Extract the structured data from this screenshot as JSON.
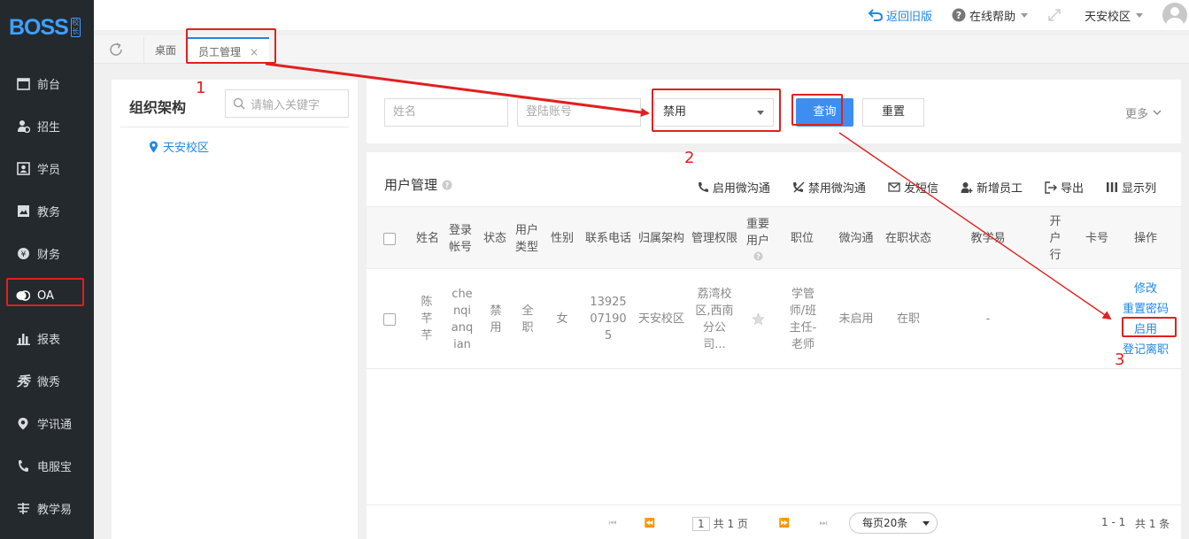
{
  "logo": {
    "text": "BOSS",
    "sub": "校长"
  },
  "sidebar": {
    "items": [
      {
        "label": "前台",
        "icon": "calendar-icon"
      },
      {
        "label": "招生",
        "icon": "user-add-icon"
      },
      {
        "label": "学员",
        "icon": "id-card-icon"
      },
      {
        "label": "教务",
        "icon": "book-icon"
      },
      {
        "label": "财务",
        "icon": "yen-icon"
      },
      {
        "label": "OA",
        "icon": "chat-bubbles-icon"
      },
      {
        "label": "报表",
        "icon": "bar-chart-icon"
      },
      {
        "label": "微秀",
        "icon": "xiu-icon"
      },
      {
        "label": "学讯通",
        "icon": "location-icon"
      },
      {
        "label": "电服宝",
        "icon": "phone-service-icon"
      },
      {
        "label": "教学易",
        "icon": "teach-icon"
      }
    ],
    "active": "OA"
  },
  "topbar": {
    "back_old": "返回旧版",
    "help": "在线帮助",
    "campus": "天安校区"
  },
  "tabs": {
    "home": "桌面",
    "current": "员工管理",
    "close": "×"
  },
  "org": {
    "title": "组织架构",
    "search_placeholder": "请输入关键字",
    "node": "天安校区"
  },
  "filter": {
    "name_placeholder": "姓名",
    "account_placeholder": "登陆账号",
    "status_selected": "禁用",
    "query": "查询",
    "reset": "重置",
    "more": "更多"
  },
  "panel": {
    "title": "用户管理",
    "tools": [
      "启用微沟通",
      "禁用微沟通",
      "发短信",
      "新增员工",
      "导出",
      "显示列"
    ]
  },
  "table": {
    "headers": {
      "name": "姓名",
      "account": "登录帐号",
      "status": "状态",
      "user_type": "用户类型",
      "gender": "性别",
      "phone": "联系电话",
      "org": "归属架构",
      "perm": "管理权限",
      "vip": "重要用户",
      "position": "职位",
      "wechat": "微沟通",
      "job_status": "在职状态",
      "teach": "教学易",
      "bank": "开户行",
      "card": "卡号",
      "ops": "操作"
    },
    "rows": [
      {
        "name": "陈芊芊",
        "account": "chenqianqian",
        "status": "禁用",
        "user_type": "全职",
        "gender": "女",
        "phone": "13925071905",
        "org": "天安校区",
        "perm": "荔湾校区,西南分公司...",
        "position": "学管师/班主任-老师",
        "wechat": "未启用",
        "job_status": "在职",
        "teach": "-",
        "ops": [
          "修改",
          "重置密码",
          "启用",
          "登记离职"
        ]
      }
    ]
  },
  "pager": {
    "page": "1",
    "total_pages": "共 1 页",
    "page_size": "每页20条",
    "range": "1 - 1",
    "total": "共 1 条"
  },
  "annotations": {
    "a1": "1",
    "a2": "2",
    "a3": "3",
    "color": "#e02020"
  }
}
